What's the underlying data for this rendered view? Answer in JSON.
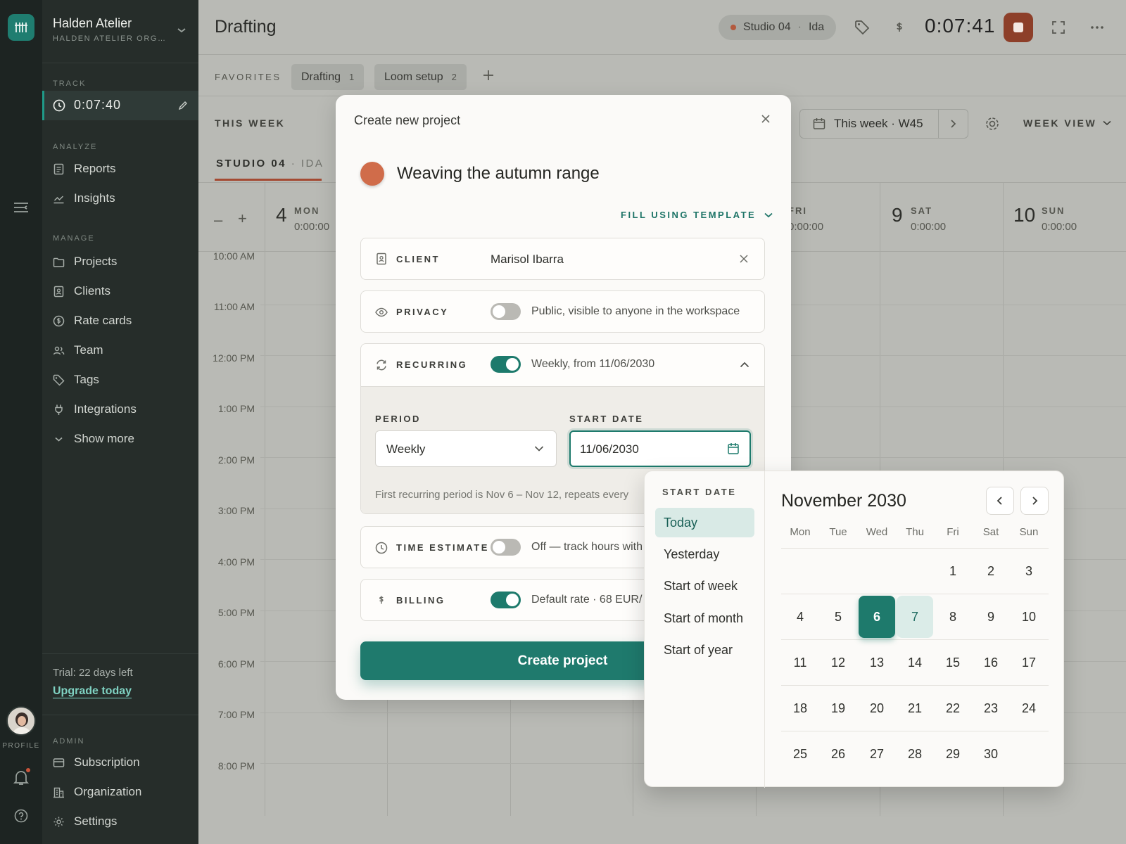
{
  "workspace": {
    "name": "Halden Atelier",
    "subtitle": "HALDEN ATELIER ORG…"
  },
  "sidebar": {
    "track_label": "TRACK",
    "track_time": "0:07:40",
    "analyze_label": "ANALYZE",
    "analyze": [
      {
        "label": "Reports"
      },
      {
        "label": "Insights"
      }
    ],
    "manage_label": "MANAGE",
    "manage": [
      {
        "label": "Projects"
      },
      {
        "label": "Clients"
      },
      {
        "label": "Rate cards"
      },
      {
        "label": "Team"
      },
      {
        "label": "Tags"
      },
      {
        "label": "Integrations"
      },
      {
        "label": "Show more"
      }
    ],
    "trial_text": "Trial: 22 days left",
    "upgrade_label": "Upgrade today",
    "admin_label": "ADMIN",
    "admin": [
      {
        "label": "Subscription"
      },
      {
        "label": "Organization"
      },
      {
        "label": "Settings"
      }
    ]
  },
  "rail": {
    "profile_label": "PROFILE"
  },
  "header": {
    "title": "Drafting",
    "running_project": "Studio 04",
    "running_user": "Ida",
    "timer": "0:07:41",
    "accent": "#1f7a6d",
    "stop_color": "#8d3f29"
  },
  "favorites": {
    "label": "FAVORITES",
    "items": [
      {
        "label": "Drafting",
        "count": "1"
      },
      {
        "label": "Loom setup",
        "count": "2"
      }
    ]
  },
  "week": {
    "label": "THIS WEEK",
    "tab_project": "STUDIO 04",
    "tab_user": "IDA",
    "range": "This week · W45",
    "view": "WEEK VIEW",
    "days": [
      {
        "num": "4",
        "name": "MON",
        "hours": "0:00:00"
      },
      {
        "num": "",
        "name": "FRI",
        "hours": "0:00:00"
      },
      {
        "num": "9",
        "name": "SAT",
        "hours": "0:00:00"
      },
      {
        "num": "10",
        "name": "SUN",
        "hours": "0:00:00"
      }
    ],
    "hours": [
      "10:00 AM",
      "11:00 AM",
      "12:00 PM",
      "1:00 PM",
      "2:00 PM",
      "3:00 PM",
      "4:00 PM",
      "5:00 PM",
      "6:00 PM",
      "7:00 PM",
      "8:00 PM"
    ]
  },
  "modal": {
    "title": "Create new project",
    "project_name": "Weaving the autumn range",
    "project_color": "#d06c4a",
    "fill_template": "FILL USING TEMPLATE",
    "client": {
      "label": "CLIENT",
      "value": "Marisol Ibarra"
    },
    "privacy": {
      "label": "PRIVACY",
      "enabled": false,
      "desc": "Public, visible to anyone in the workspace"
    },
    "recurring": {
      "label": "RECURRING",
      "enabled": true,
      "desc": "Weekly, from 11/06/2030",
      "period_label": "PERIOD",
      "period_value": "Weekly",
      "start_label": "START DATE",
      "start_value": "11/06/2030",
      "hint": "First recurring period is Nov 6 – Nov 12, repeats every"
    },
    "time_estimate": {
      "label": "TIME ESTIMATE",
      "enabled": false,
      "desc": "Off — track hours with"
    },
    "billing": {
      "label": "BILLING",
      "enabled": true,
      "desc": "Default rate · 68 EUR/"
    },
    "create_label": "Create project"
  },
  "datepicker": {
    "label": "START DATE",
    "presets": [
      "Today",
      "Yesterday",
      "Start of week",
      "Start of month",
      "Start of year"
    ],
    "selected_preset": "Today",
    "month": "November 2030",
    "weekdays": [
      "Mon",
      "Tue",
      "Wed",
      "Thu",
      "Fri",
      "Sat",
      "Sun"
    ],
    "weeks": [
      [
        "",
        "",
        "",
        "",
        "1",
        "2",
        "3"
      ],
      [
        "4",
        "5",
        "6",
        "7",
        "8",
        "9",
        "10"
      ],
      [
        "11",
        "12",
        "13",
        "14",
        "15",
        "16",
        "17"
      ],
      [
        "18",
        "19",
        "20",
        "21",
        "22",
        "23",
        "24"
      ],
      [
        "25",
        "26",
        "27",
        "28",
        "29",
        "30",
        ""
      ]
    ],
    "selected_day": "6",
    "today_day": "7"
  }
}
